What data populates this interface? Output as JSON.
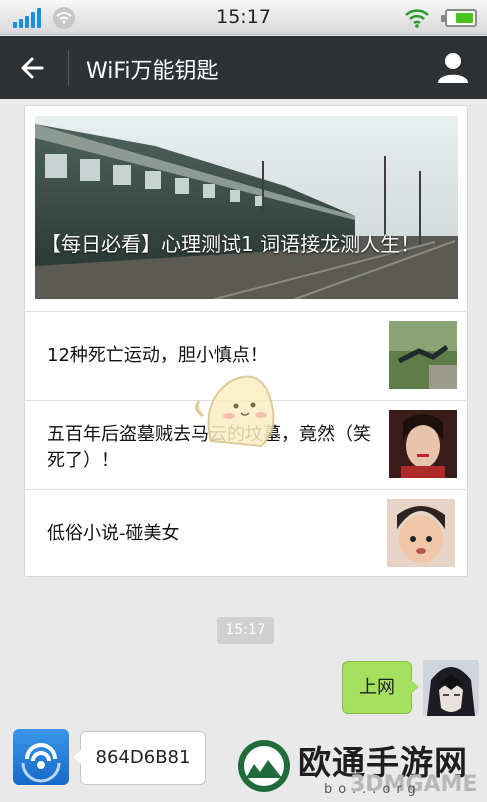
{
  "status_bar": {
    "time": "15:17",
    "signal_bars": 5,
    "battery_level": 0.7,
    "icons": [
      "signal-icon",
      "wifi-icon",
      "battery-icon"
    ]
  },
  "nav": {
    "title": "WiFi万能钥匙",
    "back_icon": "arrow-left-icon",
    "profile_icon": "person-icon"
  },
  "news": {
    "hero_title": "【每日必看】心理测试1 词语接龙测人生！",
    "items": [
      {
        "title": "12种死亡运动，胆小慎点！"
      },
      {
        "title": "五百年后盗墓贼去马云的坟墓，竟然（笑死了）！"
      },
      {
        "title": "低俗小说-碰美女"
      }
    ]
  },
  "chat": {
    "timestamp": "15:17",
    "sent_message": "上网",
    "received_message": "864D6B81"
  },
  "watermark": {
    "brand": "欧通手游网",
    "overlay": "3DMGAME",
    "domain": "bo...org"
  },
  "colors": {
    "nav_bg": "#2e3235",
    "sent_bubble": "#a5e15e",
    "accent_blue": "#1a8ee0"
  }
}
